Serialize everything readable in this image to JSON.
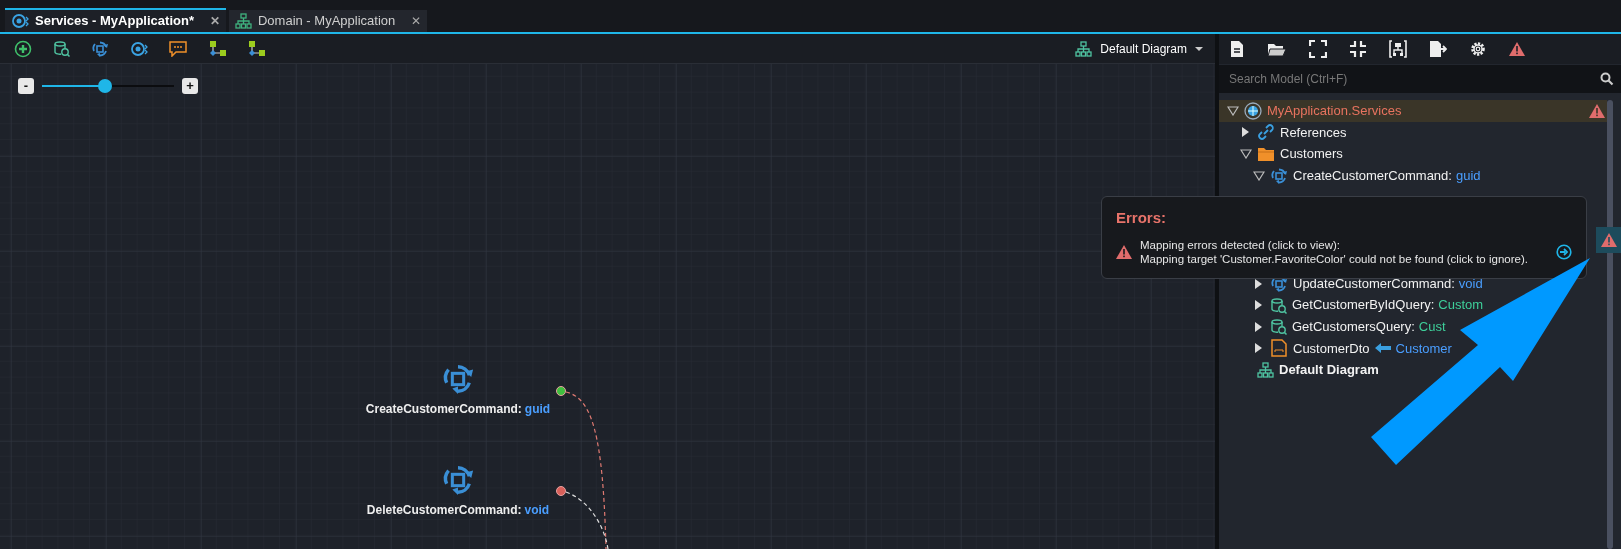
{
  "tabs": [
    {
      "label": "Services - MyApplication*",
      "selected": true,
      "kind": "services",
      "close": "✕"
    },
    {
      "label": "Domain - MyApplication",
      "selected": false,
      "kind": "domain",
      "close": "✕"
    }
  ],
  "diagram_selector": {
    "label": "Default Diagram"
  },
  "zoom": {
    "minus": "-",
    "plus": "+",
    "level": 0.48
  },
  "nodes": [
    {
      "name": "CreateCustomerCommand:",
      "type": "guid",
      "color": "#3fbf3f",
      "link_error": true
    },
    {
      "name": "DeleteCustomerCommand:",
      "type": "void",
      "color": "#d9605a",
      "link_error": false
    }
  ],
  "model_search": {
    "placeholder": "Search Model (Ctrl+F)"
  },
  "tree": {
    "label": "MyApplication.Services",
    "kind": "package",
    "expanded": true,
    "error": true,
    "children": [
      {
        "label": "References",
        "kind": "references",
        "expanded": false
      },
      {
        "label": "Customers",
        "kind": "folder",
        "expanded": true,
        "children": [
          {
            "label": "CreateCustomerCommand:",
            "type": "guid",
            "class_type": false,
            "kind": "command",
            "expanded": true
          },
          {
            "label": "UpdateCustomerCommand:",
            "type": "void",
            "class_type": false,
            "kind": "command",
            "expanded": false
          },
          {
            "label": "GetCustomerByIdQuery:",
            "type": "Custom",
            "class_type": true,
            "kind": "query",
            "expanded": false
          },
          {
            "label": "GetCustomersQuery:",
            "type": "Cust",
            "class_type": true,
            "kind": "query",
            "expanded": false
          },
          {
            "label": "CustomerDto",
            "mapped_from": "Customer",
            "kind": "dto",
            "expanded": false
          }
        ]
      },
      {
        "label": "Default Diagram",
        "kind": "diagram",
        "bold": true
      }
    ]
  },
  "error_popup": {
    "title": "Errors:",
    "lines": [
      "Mapping errors detected (click to view):",
      "Mapping target 'Customer.FavoriteColor' could not be found (click to ignore)."
    ]
  }
}
